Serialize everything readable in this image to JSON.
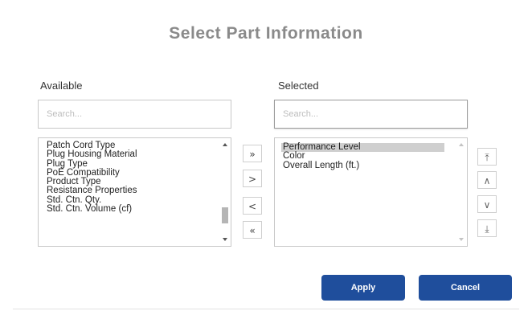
{
  "title": "Select Part Information",
  "available": {
    "label": "Available",
    "search_placeholder": "Search...",
    "items": [
      "Patch Cord Type",
      "Plug Housing Material",
      "Plug Type",
      "PoE Compatibility",
      "Product Type",
      "Resistance Properties",
      "Std. Ctn. Qty.",
      "Std. Ctn. Volume (cf)"
    ]
  },
  "selected": {
    "label": "Selected",
    "search_placeholder": "Search...",
    "items": [
      "Performance Level",
      "Color",
      "Overall Length (ft.)"
    ],
    "highlighted_index": 0
  },
  "transfer_buttons": {
    "move_all_right": "»",
    "move_right": ">",
    "move_left": "<",
    "move_all_left": "«"
  },
  "order_buttons": {
    "move_top": "⤒",
    "move_up": "∧",
    "move_down": "∨",
    "move_bottom": "⤓"
  },
  "actions": {
    "apply": "Apply",
    "cancel": "Cancel"
  },
  "colors": {
    "primary_button": "#1f4e9c",
    "title_text": "#8a8a8a",
    "selected_item_bg": "#cfcfcf"
  }
}
